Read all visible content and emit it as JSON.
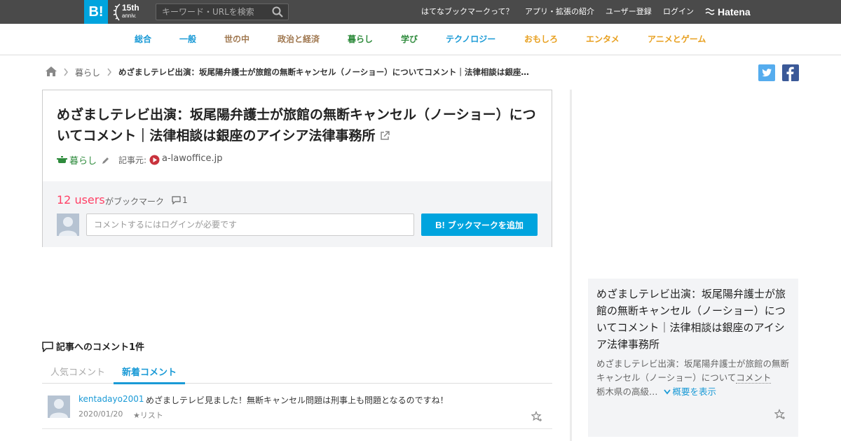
{
  "topbar": {
    "logo": "B!",
    "anniv_num": "15th",
    "anniv_txt": "anniv.",
    "search_placeholder": "キーワード・URLを検索",
    "links": [
      "はてなブックマークって？",
      "アプリ・拡張の紹介",
      "ユーザー登録",
      "ログイン"
    ],
    "hatena": "Hatena"
  },
  "categories": [
    {
      "label": "総合",
      "color": "#1a9ad6"
    },
    {
      "label": "一般",
      "color": "#1a9ad6"
    },
    {
      "label": "世の中",
      "color": "#a07850"
    },
    {
      "label": "政治と経済",
      "color": "#a07850"
    },
    {
      "label": "暮らし",
      "color": "#2e8b3c"
    },
    {
      "label": "学び",
      "color": "#2e8b3c"
    },
    {
      "label": "テクノロジー",
      "color": "#1a9ad6"
    },
    {
      "label": "おもしろ",
      "color": "#e8a020"
    },
    {
      "label": "エンタメ",
      "color": "#e8a020"
    },
    {
      "label": "アニメとゲーム",
      "color": "#e8a020"
    }
  ],
  "breadcrumb": {
    "category": "暮らし",
    "title": "めざましテレビ出演：坂尾陽弁護士が旅館の無断キャンセル（ノーショー）についてコメント｜法律相談は銀座のアイシア法律事務所"
  },
  "entry": {
    "title": "めざましテレビ出演：坂尾陽弁護士が旅館の無断キャンセル（ノーショー）についてコメント｜法律相談は銀座のアイシア法律事務所",
    "category": "暮らし",
    "source_label": "記事元:",
    "domain": "a-lawoffice.jp",
    "users": "12 users",
    "users_suffix": "がブックマーク",
    "comment_count": "1",
    "comment_placeholder": "コメントするにはログインが必要です",
    "add_button_b": "B!",
    "add_button": "ブックマークを追加"
  },
  "comments": {
    "heading": "記事へのコメント1件",
    "tabs": [
      "人気コメント",
      "新着コメント"
    ],
    "items": [
      {
        "user": "kentadayo2001",
        "text": "めざましテレビ見ました！無断キャンセル問題は刑事上も問題となるのですね！",
        "date": "2020/01/20",
        "list": "★リスト"
      }
    ]
  },
  "sidebar": {
    "title": "めざましテレビ出演：坂尾陽弁護士が旅館の無断キャンセル（ノーショー）についてコメント｜法律相談は銀座のアイシア法律事務所",
    "summary_pre": "めざましテレビ出演：坂尾陽弁護士が旅館の無断キャンセル（ノーショー）について",
    "summary_link": "コメント",
    "summary_post": "栃木県の高級…",
    "more": "概要を表示"
  }
}
